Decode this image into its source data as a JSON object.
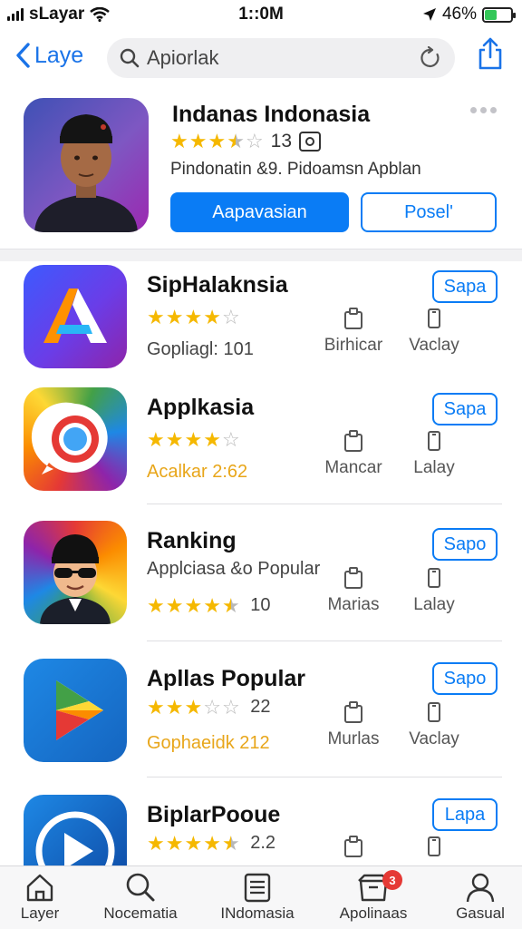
{
  "status": {
    "carrier": "sLayar",
    "time": "1::0M",
    "battery": "46%",
    "battery_level": 0.46
  },
  "nav": {
    "back_label": "Laye",
    "search_value": "Apiorlak",
    "search_placeholder": "Apiorlak"
  },
  "featured": {
    "title": "Indanas Indonasia",
    "rating": 3.5,
    "rating_count": "13",
    "subtitle": "Pindonatin &9. Pidoamsn Apblan",
    "primary_button": "Aapavasian",
    "secondary_button": "Posel'"
  },
  "apps": [
    {
      "name": "SipHalaknsia",
      "stars": 4,
      "line2": "Gopliagl: 101",
      "get": "Sapa",
      "meta1": "Birhicar",
      "meta2": "Vaclay"
    },
    {
      "name": "Applkasia",
      "stars": 4,
      "line2": "Acalkar 2:62",
      "get": "Sapa",
      "meta1": "Mancar",
      "meta2": "Lalay"
    },
    {
      "name": "Ranking",
      "subtitle": "Applciasa &o Popular",
      "stars": 4.5,
      "rating_num": "10",
      "get": "Sapo",
      "meta1": "Marias",
      "meta2": "Lalay"
    },
    {
      "name": "Apllas Popular",
      "stars": 3,
      "rating_num": "22",
      "line2": "Gophaeidk 212",
      "get": "Sapo",
      "meta1": "Murlas",
      "meta2": "Vaclay"
    },
    {
      "name": "BiplarPooue",
      "stars": 4.5,
      "rating_num": "2.2",
      "get": "Lapa"
    }
  ],
  "tabs": [
    {
      "label": "Layer",
      "icon": "home-icon"
    },
    {
      "label": "Nocematia",
      "icon": "search-icon"
    },
    {
      "label": "INdomasia",
      "icon": "list-icon"
    },
    {
      "label": "Apolinaas",
      "icon": "box-icon",
      "badge": "3"
    },
    {
      "label": "Gasual",
      "icon": "person-icon"
    }
  ],
  "colors": {
    "accent": "#0a7cf5",
    "star": "#f5b800",
    "badge": "#e53935"
  }
}
